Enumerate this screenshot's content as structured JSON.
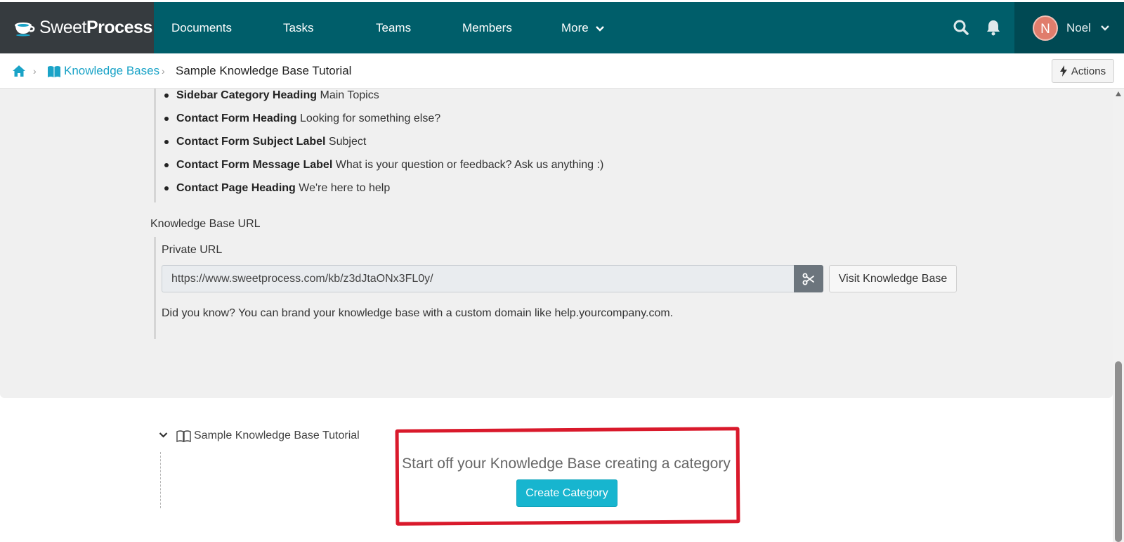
{
  "app": {
    "brand_light": "Sweet",
    "brand_bold": "Process",
    "logo_icon": "teacup-icon"
  },
  "nav": {
    "items": [
      {
        "label": "Documents"
      },
      {
        "label": "Tasks"
      },
      {
        "label": "Teams"
      },
      {
        "label": "Members"
      },
      {
        "label": "More"
      }
    ],
    "user": {
      "initial": "N",
      "name": "Noel",
      "avatar_color": "#e07d6c"
    },
    "colors": {
      "bar": "#005e6a",
      "brand_bg": "#363b3f",
      "user_bg": "#004953"
    }
  },
  "breadcrumb": {
    "home_icon": "home-icon",
    "knowledge_bases": "Knowledge Bases",
    "current": "Sample Knowledge Base Tutorial",
    "actions_label": "Actions"
  },
  "settings": {
    "items": [
      {
        "label": "Sidebar Category Heading",
        "value": "Main Topics"
      },
      {
        "label": "Contact Form Heading",
        "value": "Looking for something else?"
      },
      {
        "label": "Contact Form Subject Label",
        "value": "Subject"
      },
      {
        "label": "Contact Form Message Label",
        "value": "What is your question or feedback? Ask us anything :)"
      },
      {
        "label": "Contact Page Heading",
        "value": "We're here to help"
      }
    ],
    "kb_url_label": "Knowledge Base URL",
    "private_url_label": "Private URL",
    "private_url": "https://www.sweetprocess.com/kb/z3dJtaONx3FL0y/",
    "visit_label": "Visit Knowledge Base",
    "did_you_know": "Did you know? You can brand your knowledge base with a custom domain like help.yourcompany.com."
  },
  "tree": {
    "title": "Sample Knowledge Base Tutorial"
  },
  "empty_state": {
    "message": "Start off your Knowledge Base creating a category",
    "button_label": "Create Category",
    "button_color": "#17b5cf",
    "highlight_color": "#d9192b"
  }
}
